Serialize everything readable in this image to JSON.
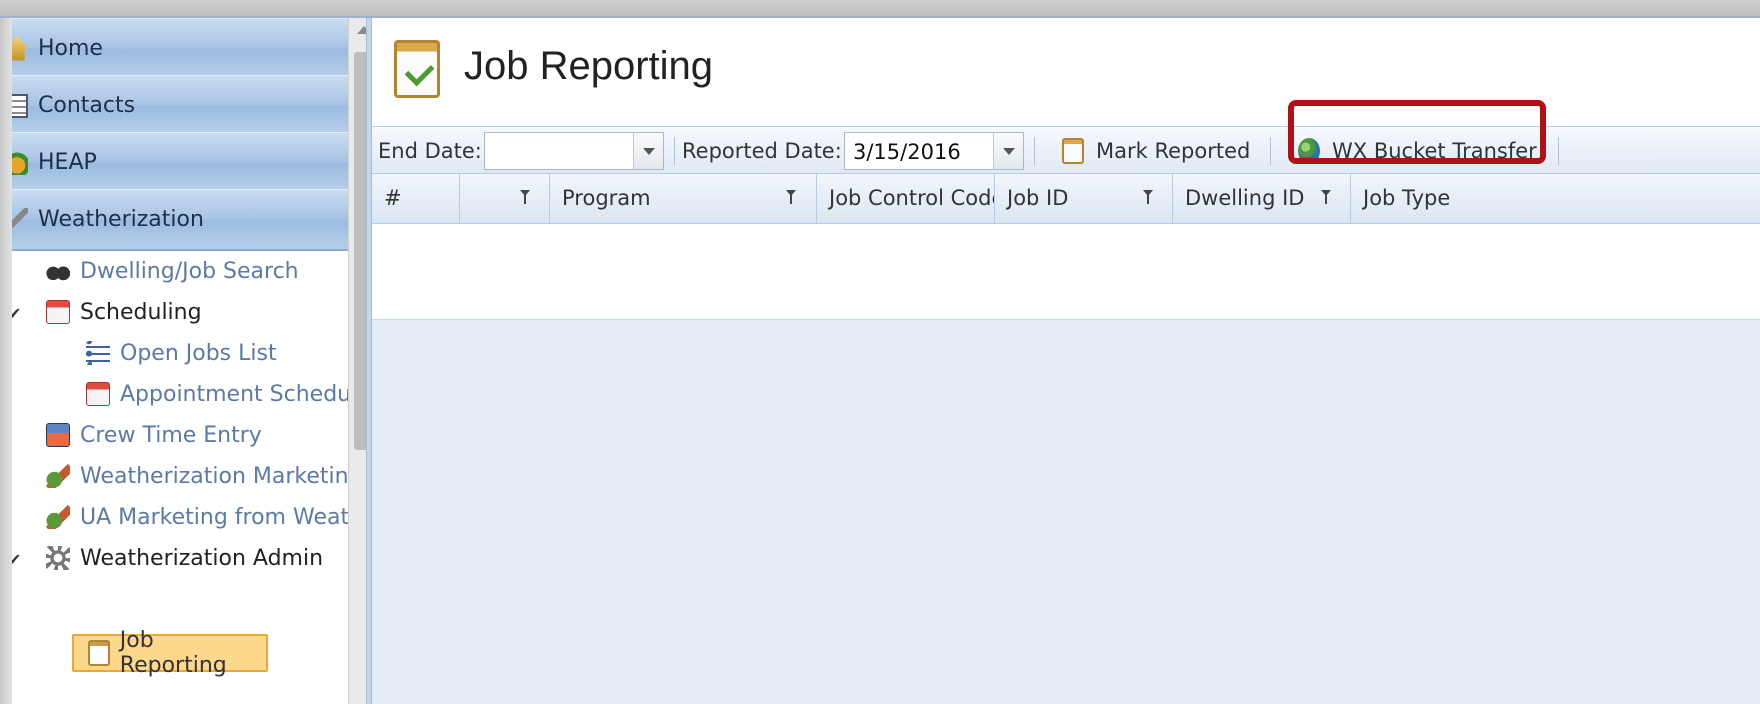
{
  "sidebar": {
    "accordion": [
      {
        "label": "Home",
        "icon": "home-icon"
      },
      {
        "label": "Contacts",
        "icon": "contacts-icon"
      },
      {
        "label": "HEAP",
        "icon": "heap-icon"
      },
      {
        "label": "Weatherization",
        "icon": "weatherization-icon"
      }
    ],
    "tree": [
      {
        "label": "Dwelling/Job Search",
        "icon": "binoculars-icon"
      },
      {
        "label": "Scheduling",
        "icon": "calendar-icon",
        "expanded": true
      },
      {
        "label": "Open Jobs List",
        "icon": "list-icon"
      },
      {
        "label": "Appointment Schedul",
        "icon": "calendar-icon"
      },
      {
        "label": "Crew Time Entry",
        "icon": "crew-time-icon"
      },
      {
        "label": "Weatherization Marketing",
        "icon": "marketing-icon"
      },
      {
        "label": "UA Marketing from Weath",
        "icon": "marketing-icon"
      },
      {
        "label": "Weatherization Admin",
        "icon": "gear-icon",
        "expanded": true
      },
      {
        "label": "Job Reporting",
        "icon": "clipboard-check-icon",
        "selected": true
      }
    ],
    "check_mark": "✔"
  },
  "page": {
    "title": "Job Reporting"
  },
  "toolbar": {
    "end_date_label": "End Date:",
    "end_date_value": "",
    "reported_date_label": "Reported Date:",
    "reported_date_value": "3/15/2016",
    "mark_reported_label": "Mark Reported",
    "wx_bucket_label": "WX Bucket Transfer"
  },
  "grid": {
    "columns": [
      "#",
      "",
      "Program",
      "Job Control Code",
      "Job ID",
      "Dwelling ID",
      "Job Type"
    ]
  },
  "colors": {
    "highlight": "#b01018",
    "selected_bg": "#fbd88c",
    "accordion": "#a8c4e4"
  }
}
